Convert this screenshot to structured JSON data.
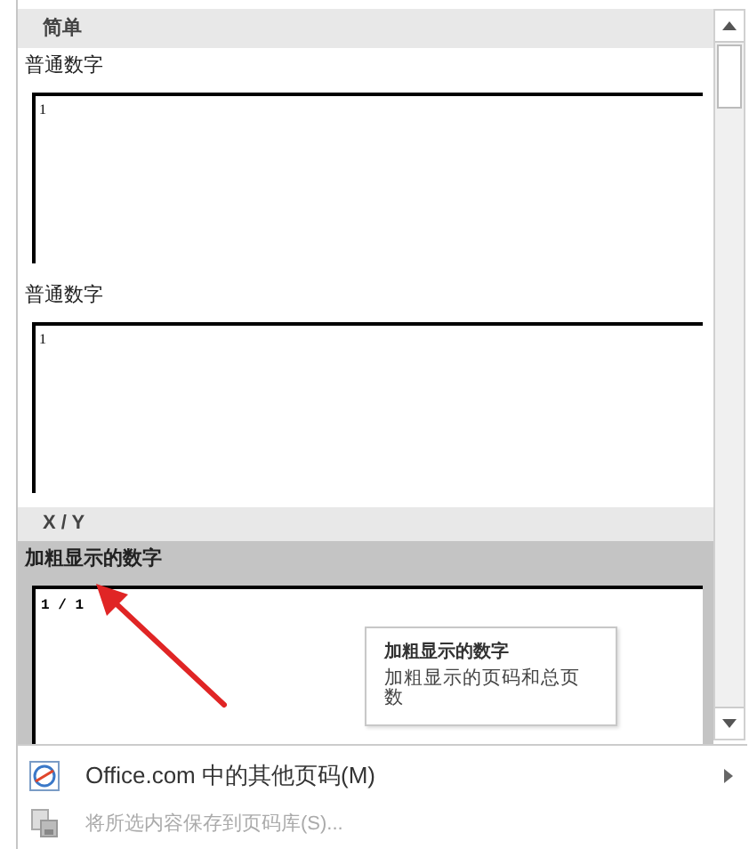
{
  "gallery": {
    "categories": [
      {
        "title": "简单",
        "items": [
          {
            "label": "普通数字",
            "preview": "1",
            "kind": "plain",
            "selected": false
          },
          {
            "label": "普通数字",
            "preview": "1",
            "kind": "plain",
            "selected": false
          }
        ]
      },
      {
        "title": "X / Y",
        "items": [
          {
            "label": "加粗显示的数字",
            "preview": "1 / 1",
            "kind": "bold",
            "selected": true
          }
        ]
      }
    ]
  },
  "tooltip": {
    "title": "加粗显示的数字",
    "description": "加粗显示的页码和总页数"
  },
  "menu": [
    {
      "label": "Office.com 中的其他页码(M)",
      "disabled": false,
      "submenu": true,
      "kind": "online"
    },
    {
      "label": "将所选内容保存到页码库(S)...",
      "disabled": true,
      "submenu": false,
      "kind": "save"
    }
  ]
}
